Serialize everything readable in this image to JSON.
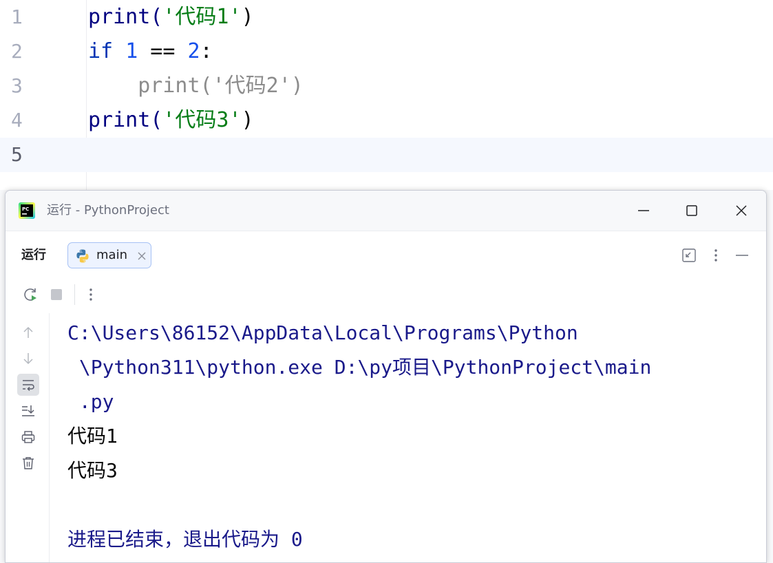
{
  "editor": {
    "lines": [
      {
        "num": "1",
        "parts": [
          {
            "t": "print(",
            "c": "kw-call"
          },
          {
            "t": "'代码1'",
            "c": "str"
          },
          {
            "t": ")",
            "c": ""
          }
        ]
      },
      {
        "num": "2",
        "parts": [
          {
            "t": "if",
            "c": "kw"
          },
          {
            "t": " ",
            "c": ""
          },
          {
            "t": "1",
            "c": "num"
          },
          {
            "t": " == ",
            "c": ""
          },
          {
            "t": "2",
            "c": "num"
          },
          {
            "t": ":",
            "c": ""
          }
        ]
      },
      {
        "num": "3",
        "parts": [
          {
            "t": "    print('代码2')",
            "c": "dim"
          }
        ]
      },
      {
        "num": "4",
        "parts": [
          {
            "t": "print(",
            "c": "kw-call"
          },
          {
            "t": "'代码3'",
            "c": "str"
          },
          {
            "t": ")",
            "c": ""
          }
        ]
      },
      {
        "num": "5",
        "parts": []
      }
    ],
    "current_line": "5"
  },
  "run_window": {
    "title": "运行 - PythonProject",
    "label": "运行",
    "tab_label": "main",
    "console": {
      "lines": [
        {
          "text": "C:\\Users\\86152\\AppData\\Local\\Programs\\Python",
          "kind": "c-path"
        },
        {
          "text": " \\Python311\\python.exe D:\\py项目\\PythonProject\\main",
          "kind": "c-path"
        },
        {
          "text": " .py",
          "kind": "c-path"
        },
        {
          "text": "代码1",
          "kind": "c-out"
        },
        {
          "text": "代码3",
          "kind": "c-out"
        },
        {
          "text": "",
          "kind": "c-out"
        },
        {
          "text": "进程已结束，退出代码为 0",
          "kind": "c-exit"
        }
      ]
    }
  },
  "icons": {
    "app": "pycharm-icon",
    "minimize": "minimize-icon",
    "maximize": "maximize-icon",
    "close": "close-icon",
    "python": "python-icon",
    "tab_close": "tab-close-icon",
    "restore_layout": "restore-layout-icon",
    "more": "more-vertical-icon",
    "hide": "hide-icon",
    "rerun": "rerun-icon",
    "stop": "stop-icon",
    "up": "arrow-up-icon",
    "down": "arrow-down-icon",
    "soft_wrap": "soft-wrap-icon",
    "scroll_end": "scroll-to-end-icon",
    "print": "print-icon",
    "trash": "trash-icon"
  },
  "colors": {
    "keyword": "#0033b3",
    "string": "#067d17",
    "number": "#1750eb",
    "call": "#000080",
    "console_path": "#1a1a8a",
    "tab_border": "#a6c1f4",
    "tab_bg": "#edf3ff"
  }
}
